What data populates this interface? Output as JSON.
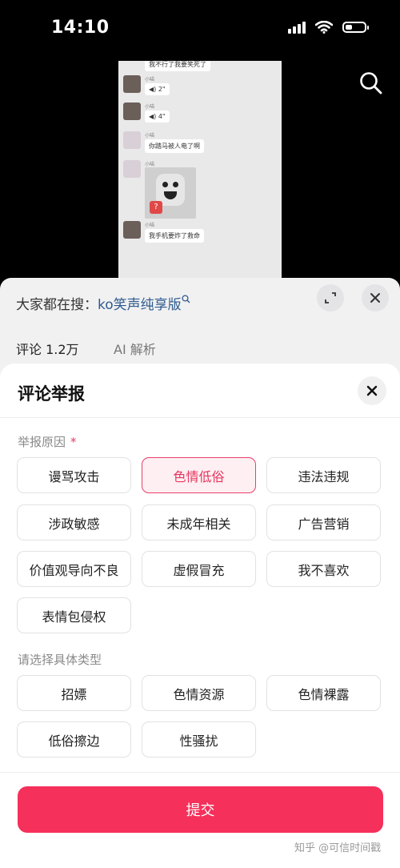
{
  "status_bar": {
    "time": "14:10"
  },
  "video": {
    "messages": [
      {
        "nick": "",
        "text": "我不行了我要笑死了"
      },
      {
        "nick": "小喵",
        "text": "◀) 2\""
      },
      {
        "nick": "小喵",
        "text": "◀) 4\""
      },
      {
        "nick": "小喵",
        "text": "你踏马被人电了啊"
      },
      {
        "nick": "小喵",
        "text": ""
      },
      {
        "nick": "小喵",
        "text": "我手机要炸了救命"
      }
    ],
    "sticker_badge": "?"
  },
  "comments_panel": {
    "hot_search_prefix": "大家都在搜：",
    "hot_search_keyword": "ko笑声纯享版",
    "tab_comments": "评论 1.2万",
    "tab_ai": "AI 解析"
  },
  "report_sheet": {
    "title": "评论举报",
    "reason_label": "举报原因",
    "required_mark": "*",
    "reasons": [
      "谩骂攻击",
      "色情低俗",
      "违法违规",
      "涉政敏感",
      "未成年相关",
      "广告营销",
      "价值观导向不良",
      "虚假冒充",
      "我不喜欢",
      "表情包侵权"
    ],
    "selected_reason": "色情低俗",
    "subtype_label": "请选择具体类型",
    "subtypes": [
      "招嫖",
      "色情资源",
      "色情裸露",
      "低俗擦边",
      "性骚扰"
    ],
    "submit_label": "提交"
  },
  "watermark": "知乎 @可信时间戳",
  "colors": {
    "accent": "#f5305b",
    "selected_text": "#e8355f",
    "keyword": "#2f5b8e"
  }
}
